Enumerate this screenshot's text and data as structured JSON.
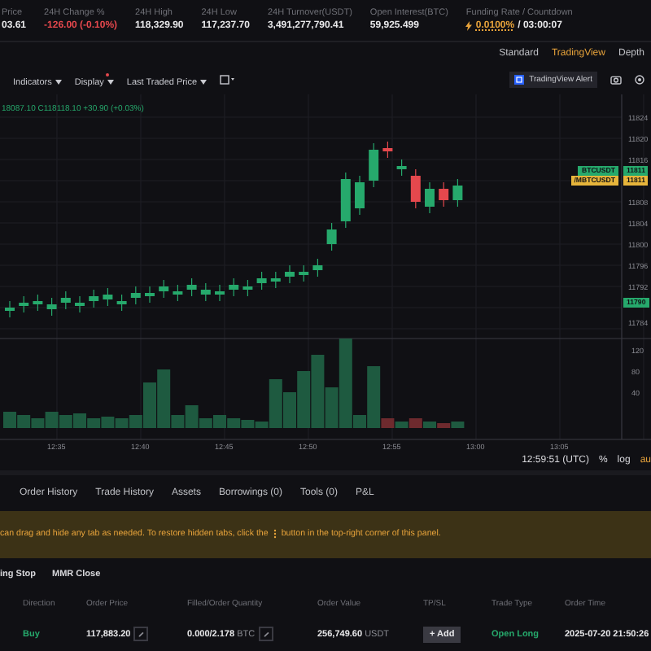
{
  "stats": [
    {
      "label": "Price",
      "value": "03.61",
      "kind": "plain"
    },
    {
      "label": "24H Change %",
      "value": "-126.00 (-0.10%)",
      "kind": "down"
    },
    {
      "label": "24H High",
      "value": "118,329.90",
      "kind": "plain"
    },
    {
      "label": "24H Low",
      "value": "117,237.70",
      "kind": "plain"
    },
    {
      "label": "24H Turnover(USDT)",
      "value": "3,491,277,790.41",
      "kind": "plain"
    },
    {
      "label": "Open Interest(BTC)",
      "value": "59,925.499",
      "kind": "plain"
    }
  ],
  "funding": {
    "label": "Funding Rate / Countdown",
    "rate": "0.0100%",
    "countdown": "/ 03:00:07"
  },
  "view_tabs": [
    {
      "label": "Standard",
      "selected": false
    },
    {
      "label": "TradingView",
      "selected": true
    },
    {
      "label": "Depth",
      "selected": false
    }
  ],
  "toolbar": [
    {
      "label": "Indicators",
      "dot": false
    },
    {
      "label": "Display",
      "dot": true
    },
    {
      "label": "Last Traded Price",
      "dot": false
    }
  ],
  "alert_button": "TradingView Alert",
  "legend": "18087.10 C118118.10 +30.90 (+0.03%)",
  "price_axis": [
    "11824",
    "11820",
    "11816",
    "11808",
    "11804",
    "11800",
    "11796",
    "11792",
    "11784"
  ],
  "price_tags": [
    {
      "symbol": "BTCUSDT",
      "value": "11811",
      "color": "#26a96c"
    },
    {
      "symbol": "/MBTCUSDT",
      "value": "11811",
      "color": "#e7b53b"
    }
  ],
  "last_tag": {
    "value": "11790",
    "color": "#26a96c"
  },
  "volume_axis": [
    "120",
    "80",
    "40"
  ],
  "time_axis": [
    "12:35",
    "12:40",
    "12:45",
    "12:50",
    "12:55",
    "13:00",
    "13:05"
  ],
  "clock": "12:59:51 (UTC)",
  "scale_options": [
    "%",
    "log",
    "au"
  ],
  "bottom_tabs": [
    "Order History",
    "Trade History",
    "Assets",
    "Borrowings (0)",
    "Tools (0)",
    "P&L"
  ],
  "notice": {
    "before": "can drag and hide any tab as needed. To restore hidden tabs, click the",
    "after": "button in the top-right corner of this panel."
  },
  "sub_tabs": [
    "ing Stop",
    "MMR Close"
  ],
  "columns": [
    "Direction",
    "Order Price",
    "Filled/Order Quantity",
    "Order Value",
    "TP/SL",
    "Trade Type",
    "Order Time"
  ],
  "rows": [
    {
      "direction": "Buy",
      "price": "117,883.20",
      "filled": "0.000/2.178",
      "filled_unit": "BTC",
      "value": "256,749.60",
      "value_unit": "USDT",
      "tpsl": "+ Add",
      "trade_type": "Open Long",
      "time": "2025-07-20 21:50:26"
    }
  ]
}
